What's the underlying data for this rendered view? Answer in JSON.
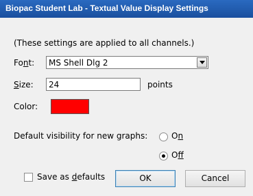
{
  "window": {
    "title": "Biopac Student Lab - Textual Value Display Settings"
  },
  "note": "(These settings are applied to all channels.)",
  "font": {
    "label": "Font:",
    "label_plain": "Fo",
    "label_ul": "n",
    "label_rest": "t:",
    "value": "MS Shell Dlg 2"
  },
  "size": {
    "label_ul": "S",
    "label_rest": "ize:",
    "value": "24",
    "unit": "points"
  },
  "color": {
    "label": "Color:",
    "value_hex": "#ff0000"
  },
  "visibility": {
    "label": "Default visibility for new graphs:",
    "on_plain": "O",
    "on_ul": "n",
    "off_plain": "O",
    "off_ul": "f",
    "off_rest": "f",
    "selected": "Off"
  },
  "save_defaults": {
    "plain": "Save as ",
    "ul": "d",
    "rest": "efaults",
    "checked": false
  },
  "buttons": {
    "ok": "OK",
    "cancel": "Cancel"
  },
  "icons": {
    "dropdown": "chevron-down-icon"
  }
}
